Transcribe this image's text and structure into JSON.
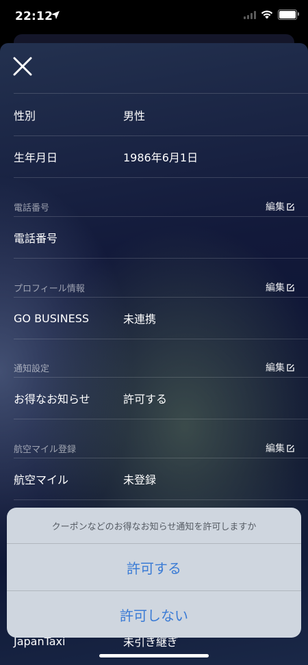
{
  "status": {
    "time": "22:12"
  },
  "profile_rows": [
    {
      "label": "性別",
      "value": "男性"
    },
    {
      "label": "生年月日",
      "value": "1986年6月1日"
    }
  ],
  "sections": [
    {
      "header": "電話番号",
      "edit_label": "編集",
      "rows": [
        {
          "label": "電話番号",
          "value": ""
        }
      ]
    },
    {
      "header": "プロフィール情報",
      "edit_label": "編集",
      "rows": [
        {
          "label": "GO BUSINESS",
          "value": "未連携"
        }
      ]
    },
    {
      "header": "通知設定",
      "edit_label": "編集",
      "rows": [
        {
          "label": "お得なお知らせ",
          "value": "許可する"
        }
      ]
    },
    {
      "header": "航空マイル登録",
      "edit_label": "編集",
      "rows": [
        {
          "label": "航空マイル",
          "value": "未登録"
        }
      ]
    }
  ],
  "hidden_row": {
    "label": "JapanTaxi",
    "value": "未引き継ぎ"
  },
  "dialog": {
    "message": "クーポンなどのお得なお知らせ通知を許可しますか",
    "allow_label": "許可する",
    "deny_label": "許可しない"
  },
  "icons": {
    "close": "close-icon",
    "edit": "edit-icon",
    "location": "location-arrow-icon",
    "wifi": "wifi-icon",
    "signal": "signal-icon",
    "battery": "battery-icon"
  },
  "colors": {
    "dialog_button": "#3a7bd5"
  }
}
